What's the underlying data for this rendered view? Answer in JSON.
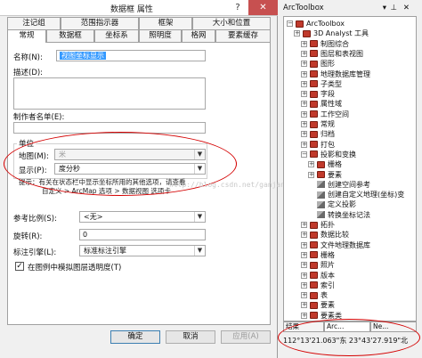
{
  "dialog": {
    "title": "数据框 属性",
    "help_label": "?",
    "close_label": "✕",
    "tabs_row1": [
      "注记组",
      "范围指示器",
      "框架",
      "大小和位置"
    ],
    "tabs_row2": [
      "常规",
      "数据框",
      "坐标系",
      "照明度",
      "格网",
      "要素缓存"
    ],
    "active_tab": "常规",
    "name_label": "名称(N):",
    "name_value": "视图坐标显示",
    "description_label": "描述(D):",
    "credits_label": "制作者名单(E):",
    "units_group_label": "单位",
    "map_units_label": "地图(M):",
    "map_units_value": "米",
    "display_units_label": "显示(P):",
    "display_units_value": "度分秒",
    "tip_line1": "提示：有关在状态栏中显示坐标所用的其他选项，请查看",
    "tip_line2": "自定义 > ArcMap 选项 > 数据视图 选项卡",
    "ref_scale_label": "参考比例(S):",
    "ref_scale_value": "<无>",
    "rotation_label": "旋转(R):",
    "rotation_value": "0",
    "label_engine_label": "标注引擎(L):",
    "label_engine_value": "标准标注引擎",
    "simulate_transparency_label": "在图例中模拟图层透明度(T)",
    "simulate_transparency_checked": true,
    "ok_label": "确定",
    "cancel_label": "取消",
    "apply_label": "应用(A)",
    "check_glyph": "✓",
    "arrow_glyph": "▼"
  },
  "watermark": "http://blog.csdn.net/ganjan004",
  "toolbox": {
    "title": "ArcToolbox",
    "close_glyph": "✕",
    "pin_glyph": "⊥",
    "dropdown_glyph": "▾",
    "plus_glyph": "+",
    "minus_glyph": "−",
    "items": [
      {
        "label": "ArcToolbox",
        "level": 0,
        "exp": "minus",
        "icon": "toolbox"
      },
      {
        "label": "3D Analyst 工具",
        "level": 1,
        "exp": "plus",
        "icon": "toolbox"
      },
      {
        "label": "制图综合",
        "level": 2,
        "exp": "plus",
        "icon": "toolbox"
      },
      {
        "label": "图层和表视图",
        "level": 2,
        "exp": "plus",
        "icon": "toolbox"
      },
      {
        "label": "图形",
        "level": 2,
        "exp": "plus",
        "icon": "toolbox"
      },
      {
        "label": "地理数据库管理",
        "level": 2,
        "exp": "plus",
        "icon": "toolbox"
      },
      {
        "label": "子类型",
        "level": 2,
        "exp": "plus",
        "icon": "toolbox"
      },
      {
        "label": "字段",
        "level": 2,
        "exp": "plus",
        "icon": "toolbox"
      },
      {
        "label": "属性域",
        "level": 2,
        "exp": "plus",
        "icon": "toolbox"
      },
      {
        "label": "工作空间",
        "level": 2,
        "exp": "plus",
        "icon": "toolbox"
      },
      {
        "label": "常规",
        "level": 2,
        "exp": "plus",
        "icon": "toolbox"
      },
      {
        "label": "归档",
        "level": 2,
        "exp": "plus",
        "icon": "toolbox"
      },
      {
        "label": "打包",
        "level": 2,
        "exp": "plus",
        "icon": "toolbox"
      },
      {
        "label": "投影和变换",
        "level": 2,
        "exp": "minus",
        "icon": "toolbox"
      },
      {
        "label": "栅格",
        "level": 3,
        "exp": "plus",
        "icon": "toolbox"
      },
      {
        "label": "要素",
        "level": 3,
        "exp": "plus",
        "icon": "toolbox"
      },
      {
        "label": "创建空间参考",
        "level": 3,
        "exp": "none",
        "icon": "tool"
      },
      {
        "label": "创建自定义地理(坐标)变",
        "level": 3,
        "exp": "none",
        "icon": "tool"
      },
      {
        "label": "定义投影",
        "level": 3,
        "exp": "none",
        "icon": "tool"
      },
      {
        "label": "转换坐标记法",
        "level": 3,
        "exp": "none",
        "icon": "tool"
      },
      {
        "label": "拓扑",
        "level": 2,
        "exp": "plus",
        "icon": "toolbox"
      },
      {
        "label": "数据比较",
        "level": 2,
        "exp": "plus",
        "icon": "toolbox"
      },
      {
        "label": "文件地理数据库",
        "level": 2,
        "exp": "plus",
        "icon": "toolbox"
      },
      {
        "label": "栅格",
        "level": 2,
        "exp": "plus",
        "icon": "toolbox"
      },
      {
        "label": "照片",
        "level": 2,
        "exp": "plus",
        "icon": "toolbox"
      },
      {
        "label": "版本",
        "level": 2,
        "exp": "plus",
        "icon": "toolbox"
      },
      {
        "label": "索引",
        "level": 2,
        "exp": "plus",
        "icon": "toolbox"
      },
      {
        "label": "表",
        "level": 2,
        "exp": "plus",
        "icon": "toolbox"
      },
      {
        "label": "要素",
        "level": 2,
        "exp": "plus",
        "icon": "toolbox"
      },
      {
        "label": "要素类",
        "level": 2,
        "exp": "plus",
        "icon": "toolbox"
      }
    ],
    "bottom_tabs": [
      "结果",
      "Arc...",
      "Ne..."
    ],
    "status_coordinates": "112°13'21.063\"东  23°43'27.919\"北"
  }
}
